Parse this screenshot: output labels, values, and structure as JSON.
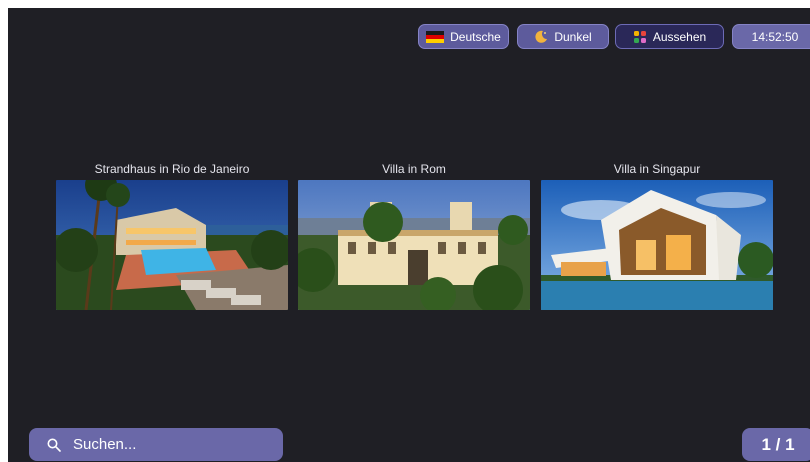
{
  "topbar": {
    "language_label": "Deutsche",
    "language_icon": "german-flag-icon",
    "theme_label": "Dunkel",
    "theme_icon": "moon-icon",
    "appearance_label": "Aussehen",
    "appearance_icon": "palette-grid-icon",
    "clock": "14:52:50"
  },
  "gallery": {
    "items": [
      {
        "title": "Strandhaus in Rio de Janeiro"
      },
      {
        "title": "Villa in Rom"
      },
      {
        "title": "Villa in Singapur"
      }
    ]
  },
  "footer": {
    "search_placeholder": "Suchen...",
    "search_icon": "search-icon",
    "page_indicator": "1 / 1"
  },
  "colors": {
    "background": "#1f1f25",
    "accent": "#6a68a8",
    "accent_dark": "#2a2858"
  }
}
